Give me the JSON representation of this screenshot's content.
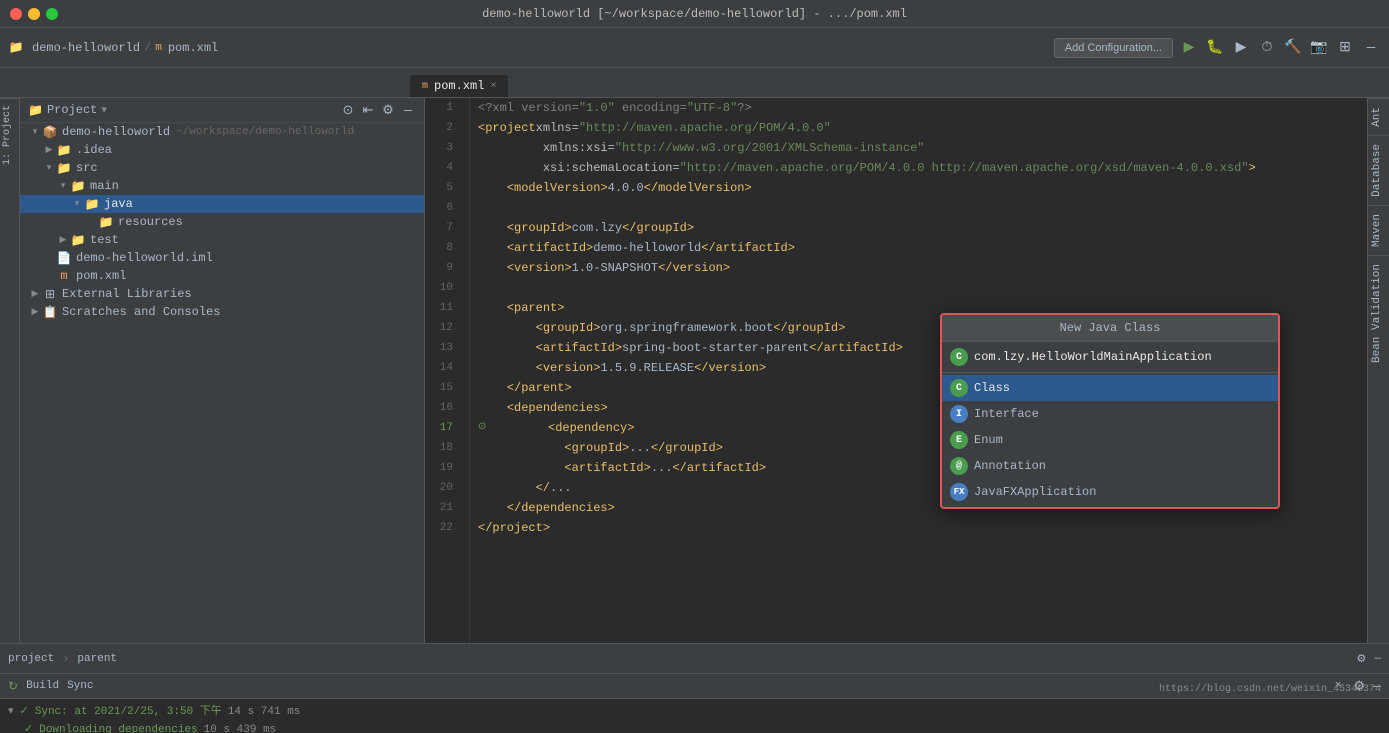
{
  "titleBar": {
    "title": "demo-helloworld [~/workspace/demo-helloworld] - .../pom.xml"
  },
  "toolbar": {
    "breadcrumb1": "demo-helloworld",
    "breadcrumb2": "pom.xml",
    "addConfigBtn": "Add Configuration...",
    "rightIcons": [
      "▶",
      "⏸",
      "⏹",
      "🔨",
      "📷",
      "⊞",
      "—"
    ]
  },
  "tabs": [
    {
      "label": "pom.xml",
      "active": true,
      "icon": "m"
    }
  ],
  "sidebar": {
    "title": "Project",
    "items": [
      {
        "label": "demo-helloworld",
        "path": "~/workspace/demo-helloworld",
        "depth": 0,
        "type": "project",
        "expanded": true
      },
      {
        "label": ".idea",
        "depth": 1,
        "type": "folder",
        "expanded": false
      },
      {
        "label": "src",
        "depth": 1,
        "type": "folder-src",
        "expanded": true
      },
      {
        "label": "main",
        "depth": 2,
        "type": "folder-main",
        "expanded": true
      },
      {
        "label": "java",
        "depth": 3,
        "type": "folder-java",
        "expanded": true,
        "selected": true
      },
      {
        "label": "resources",
        "depth": 4,
        "type": "folder-res",
        "expanded": false
      },
      {
        "label": "test",
        "depth": 2,
        "type": "folder",
        "expanded": false
      },
      {
        "label": "demo-helloworld.iml",
        "depth": 1,
        "type": "iml"
      },
      {
        "label": "pom.xml",
        "depth": 1,
        "type": "xml"
      },
      {
        "label": "External Libraries",
        "depth": 0,
        "type": "libs",
        "expanded": false
      },
      {
        "label": "Scratches and Consoles",
        "depth": 0,
        "type": "scratches",
        "expanded": false
      }
    ]
  },
  "editor": {
    "filename": "pom.xml",
    "lines": [
      {
        "num": 1,
        "code": "<?xml version=\"1.0\" encoding=\"UTF-8\"?>"
      },
      {
        "num": 2,
        "code": "<project xmlns=\"http://maven.apache.org/POM/4.0.0\""
      },
      {
        "num": 3,
        "code": "         xmlns:xsi=\"http://www.w3.org/2001/XMLSchema-instance\""
      },
      {
        "num": 4,
        "code": "         xsi:schemaLocation=\"http://maven.apache.org/POM/4.0.0 http://maven.apache.org/xsd/maven-4.0.0.xsd\">"
      },
      {
        "num": 5,
        "code": "    <modelVersion>4.0.0</modelVersion>"
      },
      {
        "num": 6,
        "code": ""
      },
      {
        "num": 7,
        "code": "    <groupId>com.lzy</groupId>"
      },
      {
        "num": 8,
        "code": "    <artifactId>demo-helloworld</artifactId>"
      },
      {
        "num": 9,
        "code": "    <version>1.0-SNAPSHOT</version>"
      },
      {
        "num": 10,
        "code": ""
      },
      {
        "num": 11,
        "code": "    <parent>"
      },
      {
        "num": 12,
        "code": "        <groupId>org.springframework.boot</groupId>"
      },
      {
        "num": 13,
        "code": "        <artifactId>spring-boot-starter-parent</artifactId>"
      },
      {
        "num": 14,
        "code": "        <version>1.5.9.RELEASE</version>"
      },
      {
        "num": 15,
        "code": "    </parent>"
      },
      {
        "num": 16,
        "code": "    <dependencies>"
      },
      {
        "num": 17,
        "code": "        <dependency>"
      },
      {
        "num": 18,
        "code": "            <groupId>...</groupId>"
      },
      {
        "num": 19,
        "code": "            <artifactId>...</artifactId>"
      },
      {
        "num": 20,
        "code": "        </..."
      },
      {
        "num": 21,
        "code": "    </dependencies>"
      },
      {
        "num": 22,
        "code": "</project>"
      }
    ]
  },
  "popup": {
    "title": "New Java Class",
    "inputValue": "com.lzy.HelloWorldMainApplication",
    "inputIcon": "C",
    "items": [
      {
        "label": "Class",
        "icon": "C",
        "iconType": "class",
        "selected": true
      },
      {
        "label": "Interface",
        "icon": "I",
        "iconType": "interface",
        "selected": false
      },
      {
        "label": "Enum",
        "icon": "E",
        "iconType": "enum",
        "selected": false
      },
      {
        "label": "Annotation",
        "icon": "@",
        "iconType": "annotation",
        "selected": false
      },
      {
        "label": "JavaFXApplication",
        "icon": "F",
        "iconType": "fx",
        "selected": false
      }
    ]
  },
  "rightSidebar": {
    "tabs": [
      "Ant",
      "Database",
      "Maven",
      "Bean Validation"
    ]
  },
  "bottomPanel": {
    "tabLabel": "Build",
    "closeLabel": "×",
    "syncLabel": "Sync",
    "items": [
      {
        "text": "✓ Sync: at 2021/2/25, 3:50 下午",
        "time": "14 s 741 ms"
      },
      {
        "text": "✓ Downloading dependencies",
        "time": "10 s 439 ms"
      }
    ]
  },
  "statusBar": {
    "breadcrumb1": "project",
    "sep1": "›",
    "breadcrumb2": "parent",
    "rightText": "https://blog.csdn.net/weixin_45345374"
  }
}
